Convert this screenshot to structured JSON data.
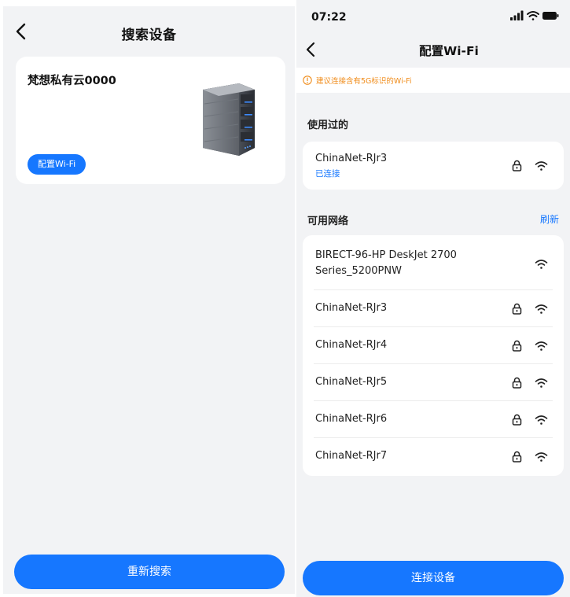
{
  "search_screen": {
    "title": "搜索设备",
    "device": {
      "name": "梵想私有云0000",
      "image_icon": "server-tower-icon",
      "config_button": "配置Wi-Fi"
    },
    "rescan_button": "重新搜索"
  },
  "wifi_screen": {
    "status_bar": {
      "time": "07:22",
      "icons": [
        "signal-icon",
        "wifi-icon",
        "battery-icon"
      ]
    },
    "title": "配置Wi-Fi",
    "notice": "建议连接含有5G标识的Wi-Fi",
    "used_section": {
      "label": "使用过的",
      "networks": [
        {
          "name": "ChinaNet-RJr3",
          "status": "已连接",
          "locked": true
        }
      ]
    },
    "available_section": {
      "label": "可用网络",
      "refresh": "刷新",
      "networks": [
        {
          "name": "BIRECT-96-HP DeskJet 2700 Series_5200PNW",
          "line1": "BIRECT-96-HP DeskJet 2700",
          "line2": "Series_5200PNW",
          "locked": false
        },
        {
          "name": "ChinaNet-RJr3",
          "locked": true
        },
        {
          "name": "ChinaNet-RJr4",
          "locked": true
        },
        {
          "name": "ChinaNet-RJr5",
          "locked": true
        },
        {
          "name": "ChinaNet-RJr6",
          "locked": true
        },
        {
          "name": "ChinaNet-RJr7",
          "locked": true
        }
      ]
    },
    "connect_button": "连接设备"
  },
  "colors": {
    "accent": "#1677ff",
    "warning": "#f08c1a",
    "background": "#f2f3f5",
    "card": "#ffffff"
  }
}
